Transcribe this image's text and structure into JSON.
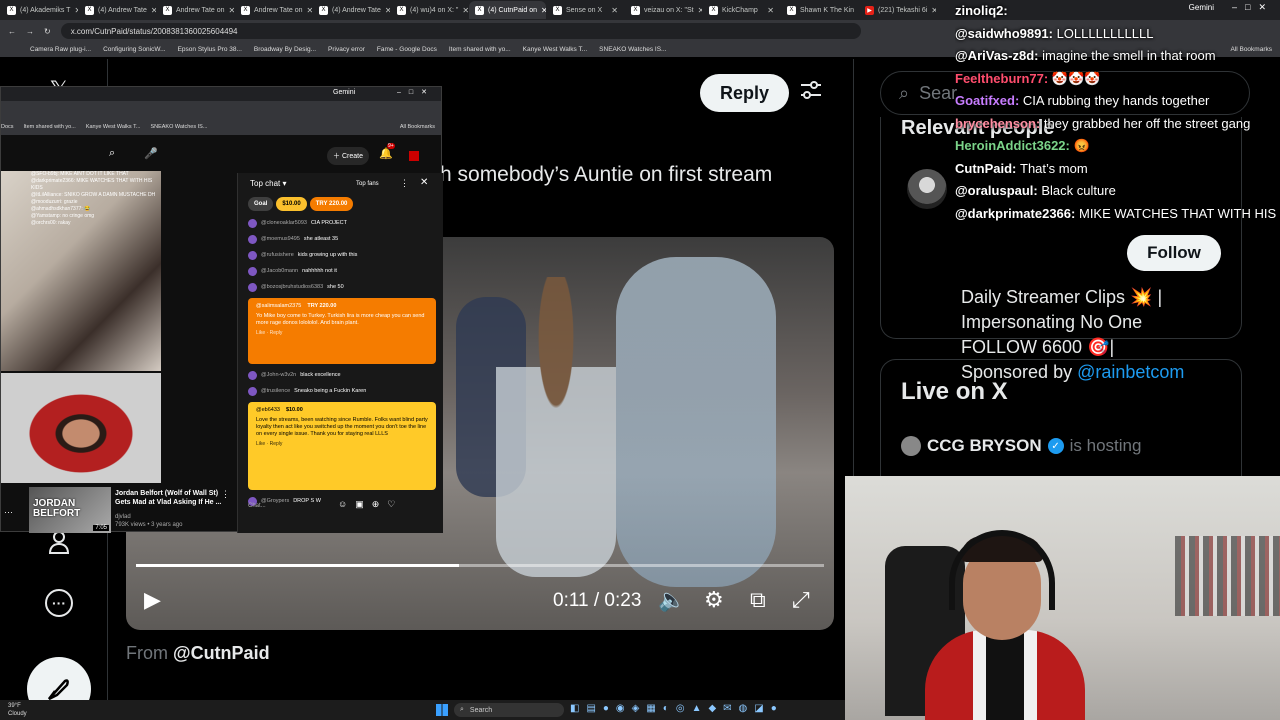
{
  "browser": {
    "tabs": [
      {
        "label": "(4) Akademiks T",
        "active": false
      },
      {
        "label": "(4) Andrew Tate",
        "active": false
      },
      {
        "label": "Andrew Tate on",
        "active": false
      },
      {
        "label": "Andrew Tate on",
        "active": false
      },
      {
        "label": "(4) Andrew Tate",
        "active": false
      },
      {
        "label": "(4) wu)4 on X: \"",
        "active": false
      },
      {
        "label": "(4) CutnPaid on",
        "active": true
      },
      {
        "label": "Sense on X",
        "active": false
      },
      {
        "label": "veizau on X: \"St",
        "active": false
      },
      {
        "label": "KickChamp",
        "active": false
      },
      {
        "label": "Shawn K The Kin",
        "active": false
      },
      {
        "label": "(221) Tekashi 6i",
        "active": false
      }
    ],
    "gemini_label": "Gemini",
    "url": "x.com/CutnPaid/status/2008381360025604494",
    "bookmarks": [
      "Camera Raw plug-i...",
      "Configuring SonicW...",
      "Epson Stylus Pro 38...",
      "Broadway By Desig...",
      "Privacy error",
      "Fame - Google Docs",
      "Item shared with yo...",
      "Kanye West Walks T...",
      "SNEAKO Watches IS..."
    ],
    "all_bookmarks": "All Bookmarks"
  },
  "post": {
    "reply_label": "Reply",
    "text": "h somebody’s Auntie on first stream",
    "from_prefix": "From",
    "from_handle": "@CutnPaid"
  },
  "video": {
    "current_time": "0:11",
    "duration": "0:23",
    "time_separator": "/",
    "progress": 0.47
  },
  "sidebar": {
    "search_placeholder": "Sear",
    "relevant_title": "Relevant people",
    "follow_label": "Follow",
    "bio_line1": "Daily Streamer Clips 💥 |",
    "bio_line2": "Impersonating No One",
    "bio_line3": "FOLLOW 6600 🎯|",
    "bio_line4_prefix": "Sponsored by",
    "bio_link": "@rainbetcom",
    "live_title": "Live on X",
    "live_host_name": "CCG BRYSON",
    "live_host_suffix": "is hosting"
  },
  "stream_chat_overlay": [
    {
      "user": "zinoliq2:",
      "msg": "",
      "color": "#ffffff"
    },
    {
      "user": "@saidwho9891:",
      "msg": "LOLLLLLLLLLLL",
      "color": "#ffffff"
    },
    {
      "user": "@AriVas-z8d:",
      "msg": "imagine the smell in that room",
      "color": "#ffffff"
    },
    {
      "user": "Feeltheburn77:",
      "msg": "🤡🤡🤡",
      "color": "#ff4d6d"
    },
    {
      "user": "Goatifxed:",
      "msg": "CIA rubbing they hands together",
      "color": "#c77dff"
    },
    {
      "user": "brycehenson:",
      "msg": "they grabbed her off the street gang",
      "color": "#ff8fa3"
    },
    {
      "user": "HeroinAddict3622:",
      "msg": "😡",
      "color": "#7bd389"
    },
    {
      "user": "CutnPaid:",
      "msg": "That’s mom",
      "color": "#ffffff"
    },
    {
      "user": "@oraluspaul:",
      "msg": "Black culture",
      "color": "#ffffff"
    },
    {
      "user": "@darkprimate2366:",
      "msg": "MIKE WATCHES THAT WITH HIS KIDS",
      "color": "#ffffff"
    }
  ],
  "inner_window": {
    "gemini_label": "Gemini",
    "bookmarks": [
      "Docs",
      "Item shared with yo...",
      "Kanye West Walks T...",
      "SNEAKO Watches IS..."
    ],
    "all_bookmarks": "All Bookmarks",
    "create_label": "Create",
    "notif_badge": "9+",
    "stream_chat_lines": [
      "@SFO-b9bj: MIKE AINT DOT IT LIKE THAT",
      "@darkprimate2366: MIKE WATCHES THAT WITH HIS KIDS",
      "@ItLilAlliance: SNIKO GROW A DAMN MUSTACHE DH",
      "@mooduzurri: grazie",
      "@ahmadhsdkhan7377: 😂",
      "@Yamstamp: no cringe omg",
      "@orchrs00: rakay"
    ],
    "rec_thumb_text": "JORDAN BELFORT",
    "rec_duration": "7:05",
    "rec_title": "Jordan Belfort (Wolf of Wall St) Gets Mad at Vlad Asking If He ...",
    "rec_channel": "djvlad",
    "rec_meta": "793K views • 3 years ago",
    "chat_header": "Top chat",
    "top_fans": "Top fans",
    "pill_goal": "Goal",
    "pill_ten": "$10.00",
    "pill_try": "TRY 220.00",
    "messages": [
      {
        "user": "@cloneoaklar5093",
        "text": "CIA PROJECT"
      },
      {
        "user": "@moemus9495",
        "text": "she atleast 35"
      },
      {
        "user": "@rufusishere",
        "text": "kids growing up with this"
      },
      {
        "user": "@Jacob0mann",
        "text": "nahhhhh not it"
      },
      {
        "user": "@bozosjbruhstudios6383",
        "text": "she 50"
      }
    ],
    "sc1_user": "@salimsalam2375",
    "sc1_amount": "TRY 220.00",
    "sc1_text": "Yo Mike boy come to Turkey. Turkish lira is more cheap you can send more rage donos lolololol. And brain plant.",
    "messages2": [
      {
        "user": "@John-w3v2n",
        "text": "black excellence"
      },
      {
        "user": "@trusilence",
        "text": "Sneako being a Fuckin Karen"
      }
    ],
    "sc2_user": "@eb6433",
    "sc2_amount": "$10.00",
    "sc2_text": "Love the streams, been watching since Rumble. Folks want blind party loyalty then act like you switched up the moment you don't toe the line on every single issue. Thank you for staying real LLLS",
    "like_label": "Like",
    "reply_label": "Reply",
    "last_msg_user": "@Groypers",
    "last_msg_text": "DROP S W",
    "chat_placeholder": "Chat..."
  },
  "taskbar": {
    "temp": "39°F",
    "weather": "Cloudy",
    "search_label": "Search"
  }
}
